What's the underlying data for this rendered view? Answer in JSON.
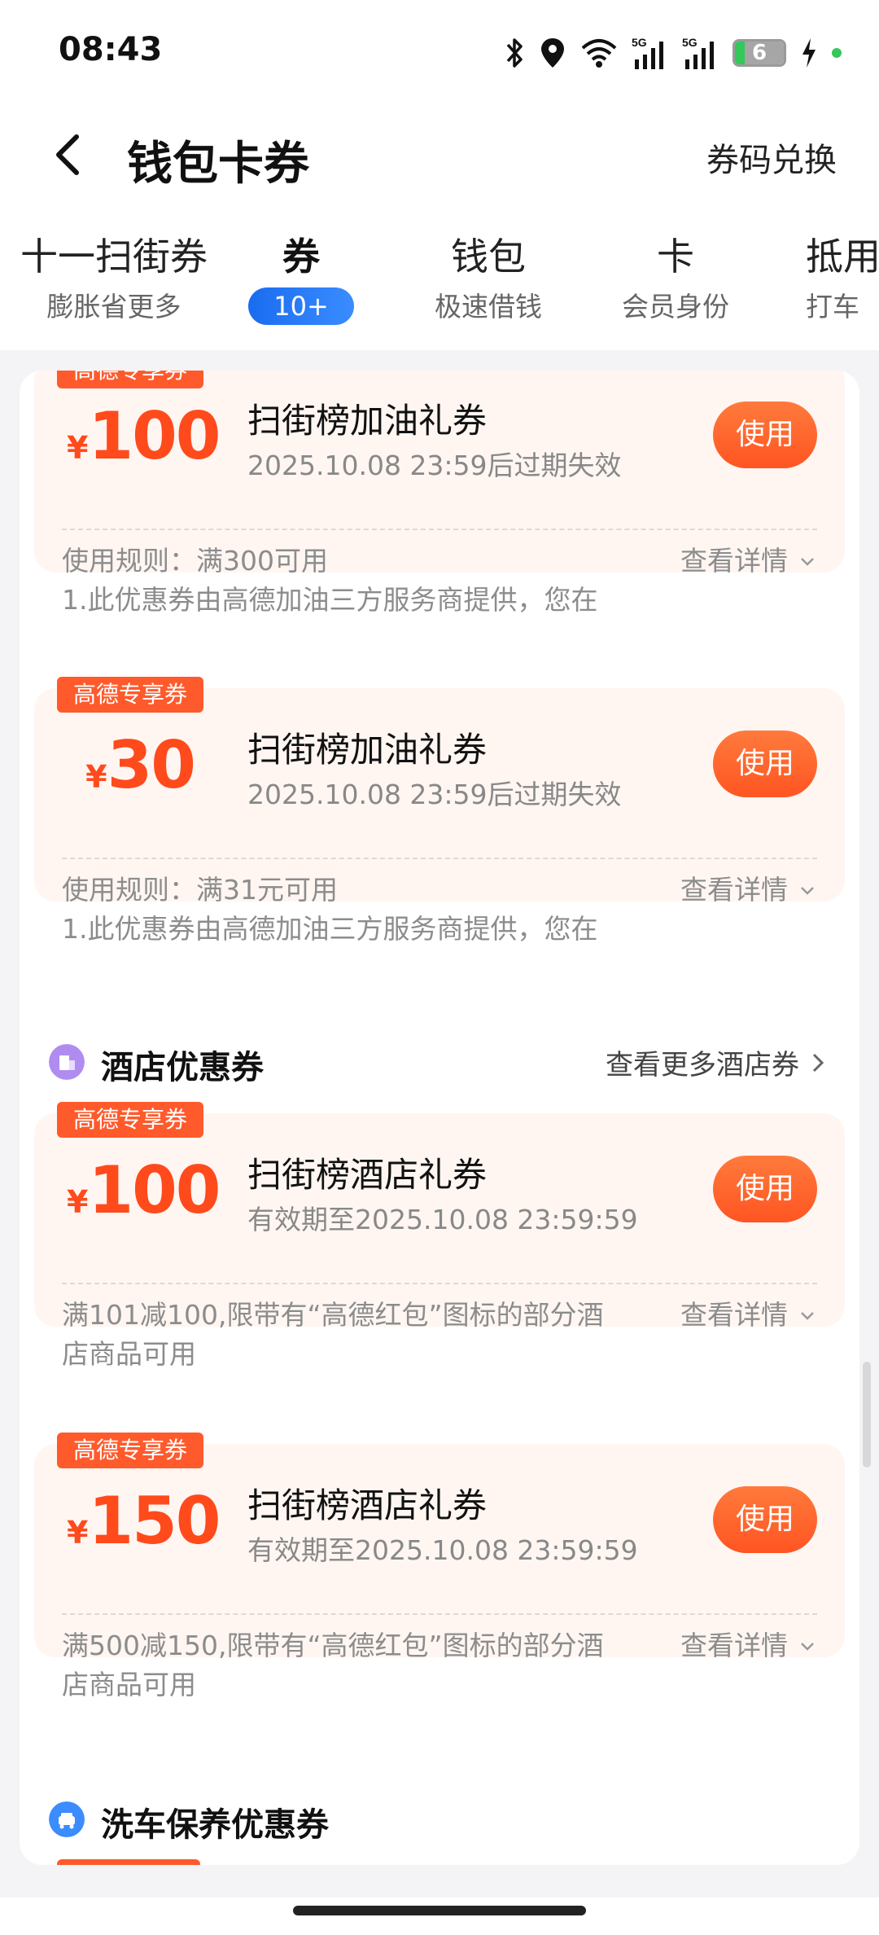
{
  "status_bar": {
    "time": "08:43",
    "battery": "6",
    "icons": [
      "bluetooth-icon",
      "location-icon",
      "wifi-icon",
      "signal-5g-icon",
      "signal-5g-icon",
      "battery-icon",
      "charging-icon"
    ]
  },
  "header": {
    "title": "钱包卡券",
    "redeem_label": "券码兑换"
  },
  "tabs": [
    {
      "label": "十一扫街券",
      "sub": "膨胀省更多"
    },
    {
      "label": "券",
      "badge": "10+"
    },
    {
      "label": "钱包",
      "sub": "极速借钱"
    },
    {
      "label": "卡",
      "sub": "会员身份"
    },
    {
      "label": "抵用",
      "sub": "打车"
    }
  ],
  "coupons_fuel": [
    {
      "tag": "高德专享券",
      "currency": "¥",
      "amount": "100",
      "title": "扫街榜加油礼券",
      "expire": "2025.10.08 23:59后过期失效",
      "use_label": "使用",
      "rule_line1": "使用规则：满300可用",
      "rule_line2": "1.此优惠券由高德加油三方服务商提供，您在",
      "detail_label": "查看详情"
    },
    {
      "tag": "高德专享券",
      "currency": "¥",
      "amount": "30",
      "title": "扫街榜加油礼券",
      "expire": "2025.10.08 23:59后过期失效",
      "use_label": "使用",
      "rule_line1": "使用规则：满31元可用",
      "rule_line2": "1.此优惠券由高德加油三方服务商提供，您在",
      "detail_label": "查看详情"
    }
  ],
  "hotel_section": {
    "title": "酒店优惠券",
    "more_label": "查看更多酒店券",
    "coupons": [
      {
        "tag": "高德专享券",
        "currency": "¥",
        "amount": "100",
        "title": "扫街榜酒店礼券",
        "expire": "有效期至2025.10.08 23:59:59",
        "use_label": "使用",
        "rule_line1": "满101减100,限带有“高德红包”图标的部分酒",
        "rule_line2": "店商品可用",
        "detail_label": "查看详情"
      },
      {
        "tag": "高德专享券",
        "currency": "¥",
        "amount": "150",
        "title": "扫街榜酒店礼券",
        "expire": "有效期至2025.10.08 23:59:59",
        "use_label": "使用",
        "rule_line1": "满500减150,限带有“高德红包”图标的部分酒",
        "rule_line2": "店商品可用",
        "detail_label": "查看详情"
      }
    ]
  },
  "carwash_section": {
    "title": "洗车保养优惠券"
  },
  "colors": {
    "accent_orange": "#ff5a2c",
    "price_red": "#ff4a1c",
    "tab_badge_blue": "#1a6cf0",
    "coupon_bg": "#fff6f2"
  }
}
